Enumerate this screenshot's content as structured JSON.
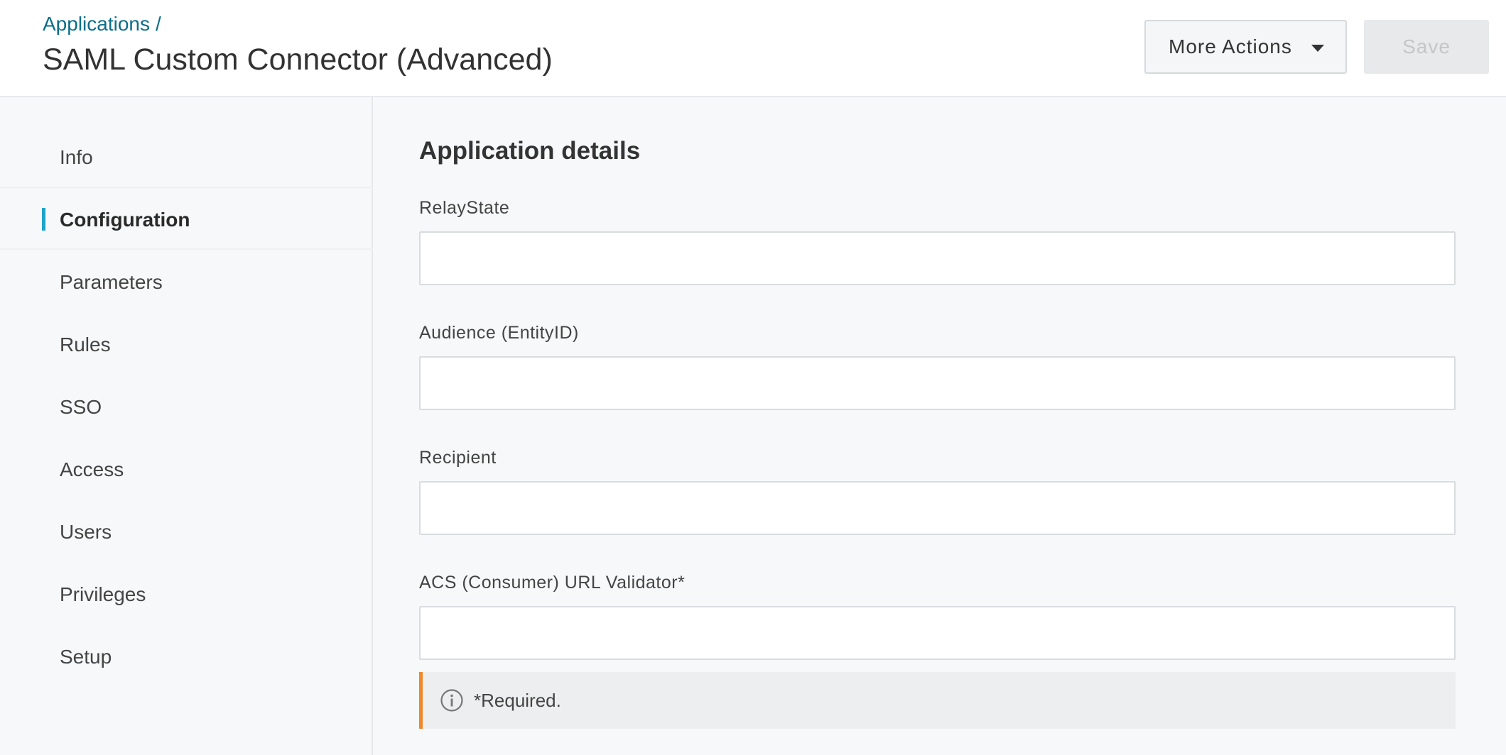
{
  "header": {
    "breadcrumb": "Applications",
    "breadcrumb_sep": "/",
    "title": "SAML Custom Connector (Advanced)",
    "more_actions_label": "More Actions",
    "save_label": "Save"
  },
  "sidebar": {
    "items": [
      {
        "label": "Info",
        "active": false
      },
      {
        "label": "Configuration",
        "active": true
      },
      {
        "label": "Parameters",
        "active": false
      },
      {
        "label": "Rules",
        "active": false
      },
      {
        "label": "SSO",
        "active": false
      },
      {
        "label": "Access",
        "active": false
      },
      {
        "label": "Users",
        "active": false
      },
      {
        "label": "Privileges",
        "active": false
      },
      {
        "label": "Setup",
        "active": false
      }
    ]
  },
  "main": {
    "section_title": "Application details",
    "fields": [
      {
        "label": "RelayState",
        "value": ""
      },
      {
        "label": "Audience (EntityID)",
        "value": ""
      },
      {
        "label": "Recipient",
        "value": ""
      },
      {
        "label": "ACS (Consumer) URL Validator*",
        "value": ""
      }
    ],
    "notice": {
      "icon": "info-icon",
      "text": "*Required."
    }
  },
  "colors": {
    "link": "#0b6e8a",
    "active_indicator": "#1ea4c7",
    "notice_accent": "#f0882a"
  }
}
